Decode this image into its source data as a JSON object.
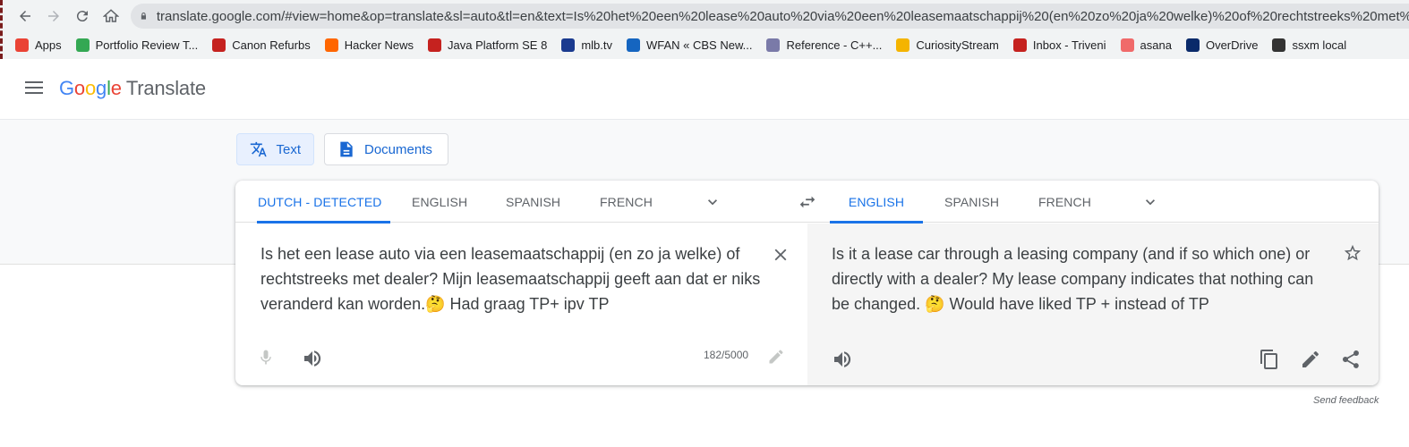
{
  "browser": {
    "url": "translate.google.com/#view=home&op=translate&sl=auto&tl=en&text=Is%20het%20een%20lease%20auto%20via%20een%20leasemaatschappij%20(en%20zo%20ja%20welke)%20of%20rechtstreeks%20met%",
    "bookmarks": [
      {
        "label": "Apps",
        "icon": "apps-grid-icon",
        "color": "#ea4335"
      },
      {
        "label": "Portfolio Review T...",
        "icon": "portfolio-icon",
        "color": "#34a853"
      },
      {
        "label": "Canon Refurbs",
        "icon": "canon-icon",
        "color": "#c5221f"
      },
      {
        "label": "Hacker News",
        "icon": "hacker-news-icon",
        "color": "#ff6600"
      },
      {
        "label": "Java Platform SE 8",
        "icon": "java-icon",
        "color": "#c5221f"
      },
      {
        "label": "mlb.tv",
        "icon": "mlb-icon",
        "color": "#1a3a8f"
      },
      {
        "label": "WFAN « CBS New...",
        "icon": "wfan-icon",
        "color": "#1565c0"
      },
      {
        "label": "Reference - C++...",
        "icon": "reference-icon",
        "color": "#7a7aa8"
      },
      {
        "label": "CuriosityStream",
        "icon": "curiosity-icon",
        "color": "#f4b400"
      },
      {
        "label": "Inbox - Triveni",
        "icon": "gmail-icon",
        "color": "#c5221f"
      },
      {
        "label": "asana",
        "icon": "asana-icon",
        "color": "#f06a6a"
      },
      {
        "label": "OverDrive",
        "icon": "overdrive-icon",
        "color": "#0a2a6a"
      },
      {
        "label": "ssxm local",
        "icon": "ssxm-icon",
        "color": "#333333"
      }
    ]
  },
  "app": {
    "logo_google": "Google",
    "logo_translate": "Translate"
  },
  "modes": {
    "text_label": "Text",
    "documents_label": "Documents"
  },
  "source": {
    "tabs": [
      "DUTCH - DETECTED",
      "ENGLISH",
      "SPANISH",
      "FRENCH"
    ],
    "active_tab": 0,
    "text": "Is het een lease auto via een leasemaatschappij (en zo ja welke) of rechtstreeks met dealer? Mijn leasemaatschappij geeft aan dat er niks veranderd kan worden.🤔 Had graag TP+ ipv TP",
    "char_count": "182/5000"
  },
  "target": {
    "tabs": [
      "ENGLISH",
      "SPANISH",
      "FRENCH"
    ],
    "active_tab": 0,
    "text": "Is it a lease car through a leasing company (and if so which one) or directly with a dealer? My lease company indicates that nothing can be changed. 🤔 Would have liked TP + instead of TP"
  },
  "footer": {
    "feedback": "Send feedback"
  },
  "colors": {
    "accent": "#1a73e8",
    "active_mode_bg": "#e8f0fe"
  }
}
